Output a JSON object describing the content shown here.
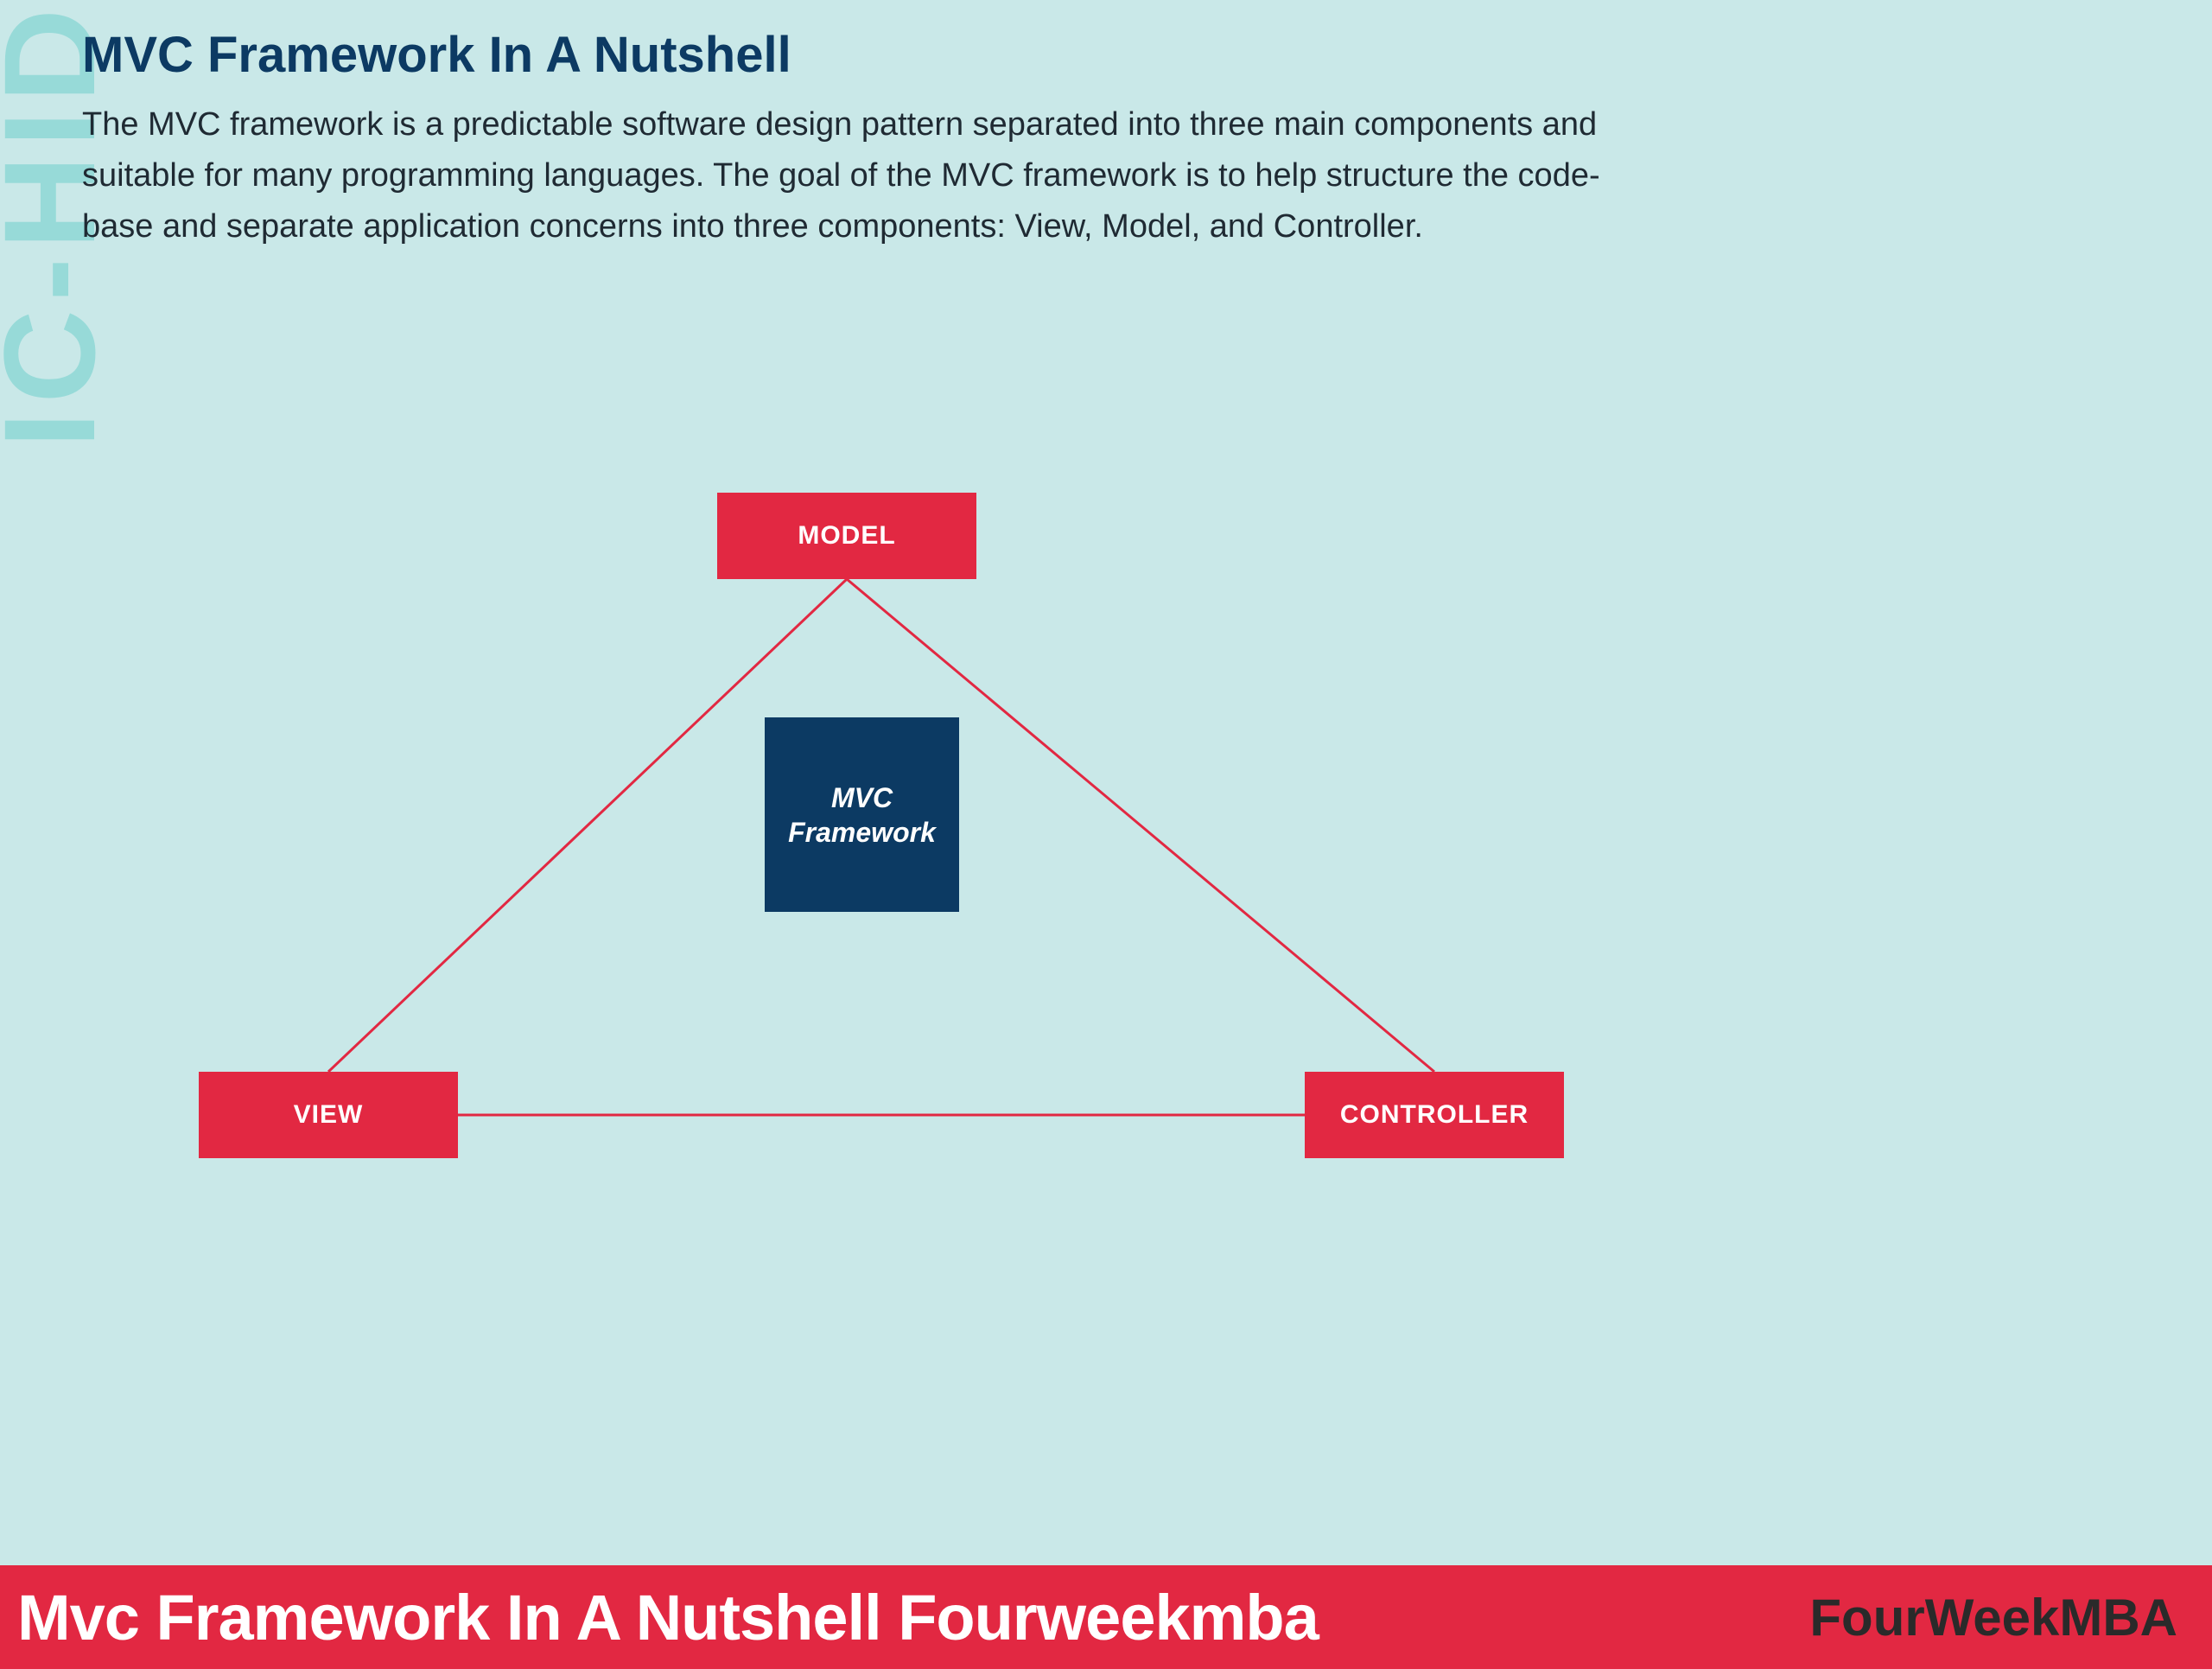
{
  "side_watermark": "IC-HID",
  "header": {
    "title": "MVC Framework In A Nutshell",
    "description": "The MVC framework is a predictable software design pattern separated into three main components and suitable for many programming languages. The goal of the MVC framework is to help structure the code-base and separate application concerns into three components: View, Model, and Controller."
  },
  "diagram": {
    "center_label_line1": "MVC",
    "center_label_line2": "Framework",
    "nodes": {
      "top": "MODEL",
      "left": "VIEW",
      "right": "CONTROLLER"
    },
    "edges": [
      [
        "top",
        "left"
      ],
      [
        "top",
        "right"
      ],
      [
        "left",
        "right"
      ]
    ]
  },
  "footer": {
    "banner_text": "Mvc Framework In A Nutshell Fourweekmba",
    "watermark": "FourWeekMBA"
  },
  "colors": {
    "background": "#c9e8e8",
    "accent_red": "#e22842",
    "accent_navy": "#0c3a63",
    "side_text": "#7dd4d1"
  }
}
